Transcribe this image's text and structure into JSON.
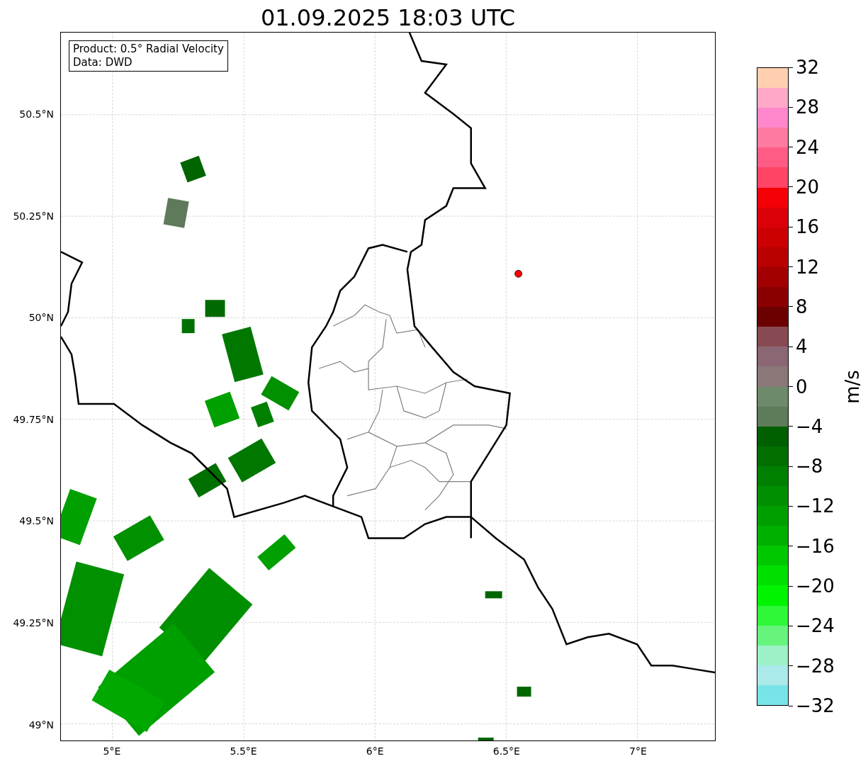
{
  "title": "01.09.2025 18:03 UTC",
  "info_box": {
    "lines": [
      "Product: 0.5° Radial Velocity",
      "Data: DWD"
    ]
  },
  "map": {
    "y_ticks": [
      "50.5°N",
      "50.25°N",
      "50°N",
      "49.75°N",
      "49.5°N",
      "49.25°N",
      "49°N"
    ],
    "x_ticks": [
      "5°E",
      "5.5°E",
      "6°E",
      "6.5°E",
      "7°E"
    ]
  },
  "colorbar": {
    "label": "m/s",
    "ticks": [
      "32",
      "28",
      "24",
      "20",
      "16",
      "12",
      "8",
      "4",
      "0",
      "−4",
      "−8",
      "−12",
      "−16",
      "−20",
      "−24",
      "−28",
      "−32"
    ],
    "bins": [
      {
        "color": "#ffcfb0"
      },
      {
        "color": "#ffa8c8"
      },
      {
        "color": "#ff88cc"
      },
      {
        "color": "#ff7aa0"
      },
      {
        "color": "#ff5c85"
      },
      {
        "color": "#ff4466"
      },
      {
        "color": "#f40006"
      },
      {
        "color": "#dc0008"
      },
      {
        "color": "#cc0000"
      },
      {
        "color": "#b80000"
      },
      {
        "color": "#a20000"
      },
      {
        "color": "#8a0000"
      },
      {
        "color": "#6b0000"
      },
      {
        "color": "#884a52"
      },
      {
        "color": "#8b6773"
      },
      {
        "color": "#8a7878"
      },
      {
        "color": "#6d8a6a"
      },
      {
        "color": "#5d7d5a"
      },
      {
        "color": "#005f00"
      },
      {
        "color": "#006f00"
      },
      {
        "color": "#007f00"
      },
      {
        "color": "#008f00"
      },
      {
        "color": "#009f00"
      },
      {
        "color": "#00b000"
      },
      {
        "color": "#00c800"
      },
      {
        "color": "#00e000"
      },
      {
        "color": "#00f400"
      },
      {
        "color": "#2ef838"
      },
      {
        "color": "#66f47c"
      },
      {
        "color": "#9cf2c6"
      },
      {
        "color": "#ace9ea"
      },
      {
        "color": "#78e4e8"
      }
    ]
  }
}
